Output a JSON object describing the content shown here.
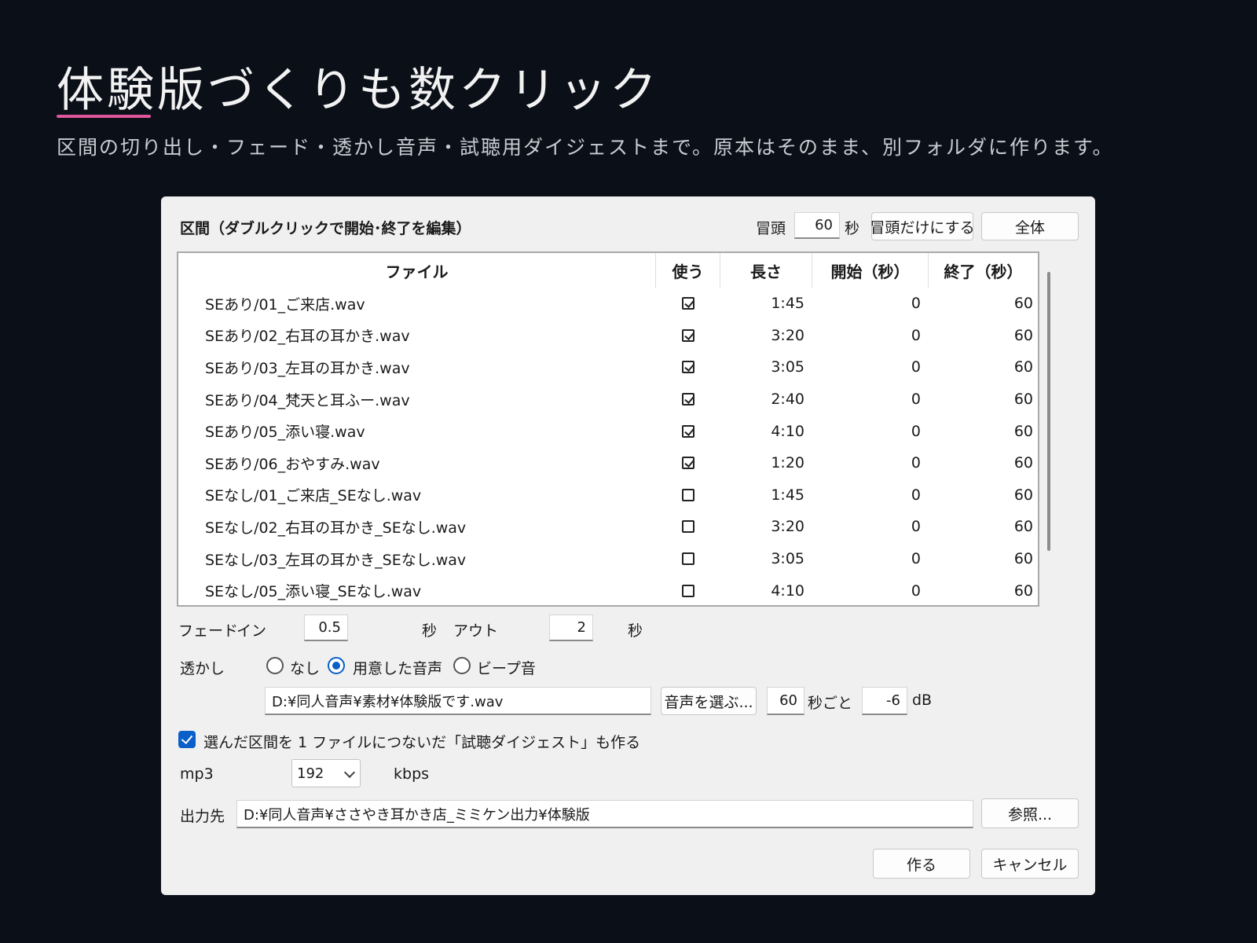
{
  "slide": {
    "title": "体験版づくりも数クリック",
    "subtitle": "区間の切り出し・フェード・透かし音声・試聴用ダイジェストまで。原本はそのまま、別フォルダに作ります。"
  },
  "dialog": {
    "section_label": "区間（ダブルクリックで開始･終了を編集）",
    "head": {
      "label": "冒頭",
      "value": "60",
      "unit": "秒",
      "head_only_button": "冒頭だけにする",
      "all_button": "全体"
    },
    "columns": {
      "file": "ファイル",
      "use": "使う",
      "length": "長さ",
      "start": "開始（秒）",
      "end": "終了（秒）"
    },
    "rows": [
      {
        "file": "SEあり/01_ご来店.wav",
        "use": true,
        "length": "1:45",
        "start": "0",
        "end": "60"
      },
      {
        "file": "SEあり/02_右耳の耳かき.wav",
        "use": true,
        "length": "3:20",
        "start": "0",
        "end": "60"
      },
      {
        "file": "SEあり/03_左耳の耳かき.wav",
        "use": true,
        "length": "3:05",
        "start": "0",
        "end": "60"
      },
      {
        "file": "SEあり/04_梵天と耳ふー.wav",
        "use": true,
        "length": "2:40",
        "start": "0",
        "end": "60"
      },
      {
        "file": "SEあり/05_添い寝.wav",
        "use": true,
        "length": "4:10",
        "start": "0",
        "end": "60"
      },
      {
        "file": "SEあり/06_おやすみ.wav",
        "use": true,
        "length": "1:20",
        "start": "0",
        "end": "60"
      },
      {
        "file": "SEなし/01_ご来店_SEなし.wav",
        "use": false,
        "length": "1:45",
        "start": "0",
        "end": "60"
      },
      {
        "file": "SEなし/02_右耳の耳かき_SEなし.wav",
        "use": false,
        "length": "3:20",
        "start": "0",
        "end": "60"
      },
      {
        "file": "SEなし/03_左耳の耳かき_SEなし.wav",
        "use": false,
        "length": "3:05",
        "start": "0",
        "end": "60"
      },
      {
        "file": "SEなし/05_添い寝_SEなし.wav",
        "use": false,
        "length": "4:10",
        "start": "0",
        "end": "60"
      }
    ],
    "fade": {
      "label": "フェード",
      "in_label": "イン",
      "in_value": "0.5",
      "in_unit": "秒",
      "out_label": "アウト",
      "out_value": "2",
      "out_unit": "秒"
    },
    "watermark": {
      "label": "透かし",
      "options": [
        {
          "label": "なし",
          "selected": false
        },
        {
          "label": "用意した音声",
          "selected": true
        },
        {
          "label": "ビープ音",
          "selected": false
        }
      ],
      "file_path": "D:¥同人音声¥素材¥体験版です.wav",
      "choose_button": "音声を選ぶ...",
      "interval_value": "60",
      "interval_unit": "秒ごと",
      "gain_value": "-6",
      "gain_unit": "dB"
    },
    "digest": {
      "checked": true,
      "label": "選んだ区間を 1 ファイルにつないだ「試聴ダイジェスト」も作る"
    },
    "mp3": {
      "label": "mp3",
      "bitrate": "192",
      "unit": "kbps"
    },
    "output": {
      "label": "出力先",
      "path": "D:¥同人音声¥ささやき耳かき店_ミミケン出力¥体験版",
      "browse_button": "参照..."
    },
    "actions": {
      "create": "作る",
      "cancel": "キャンセル"
    }
  }
}
